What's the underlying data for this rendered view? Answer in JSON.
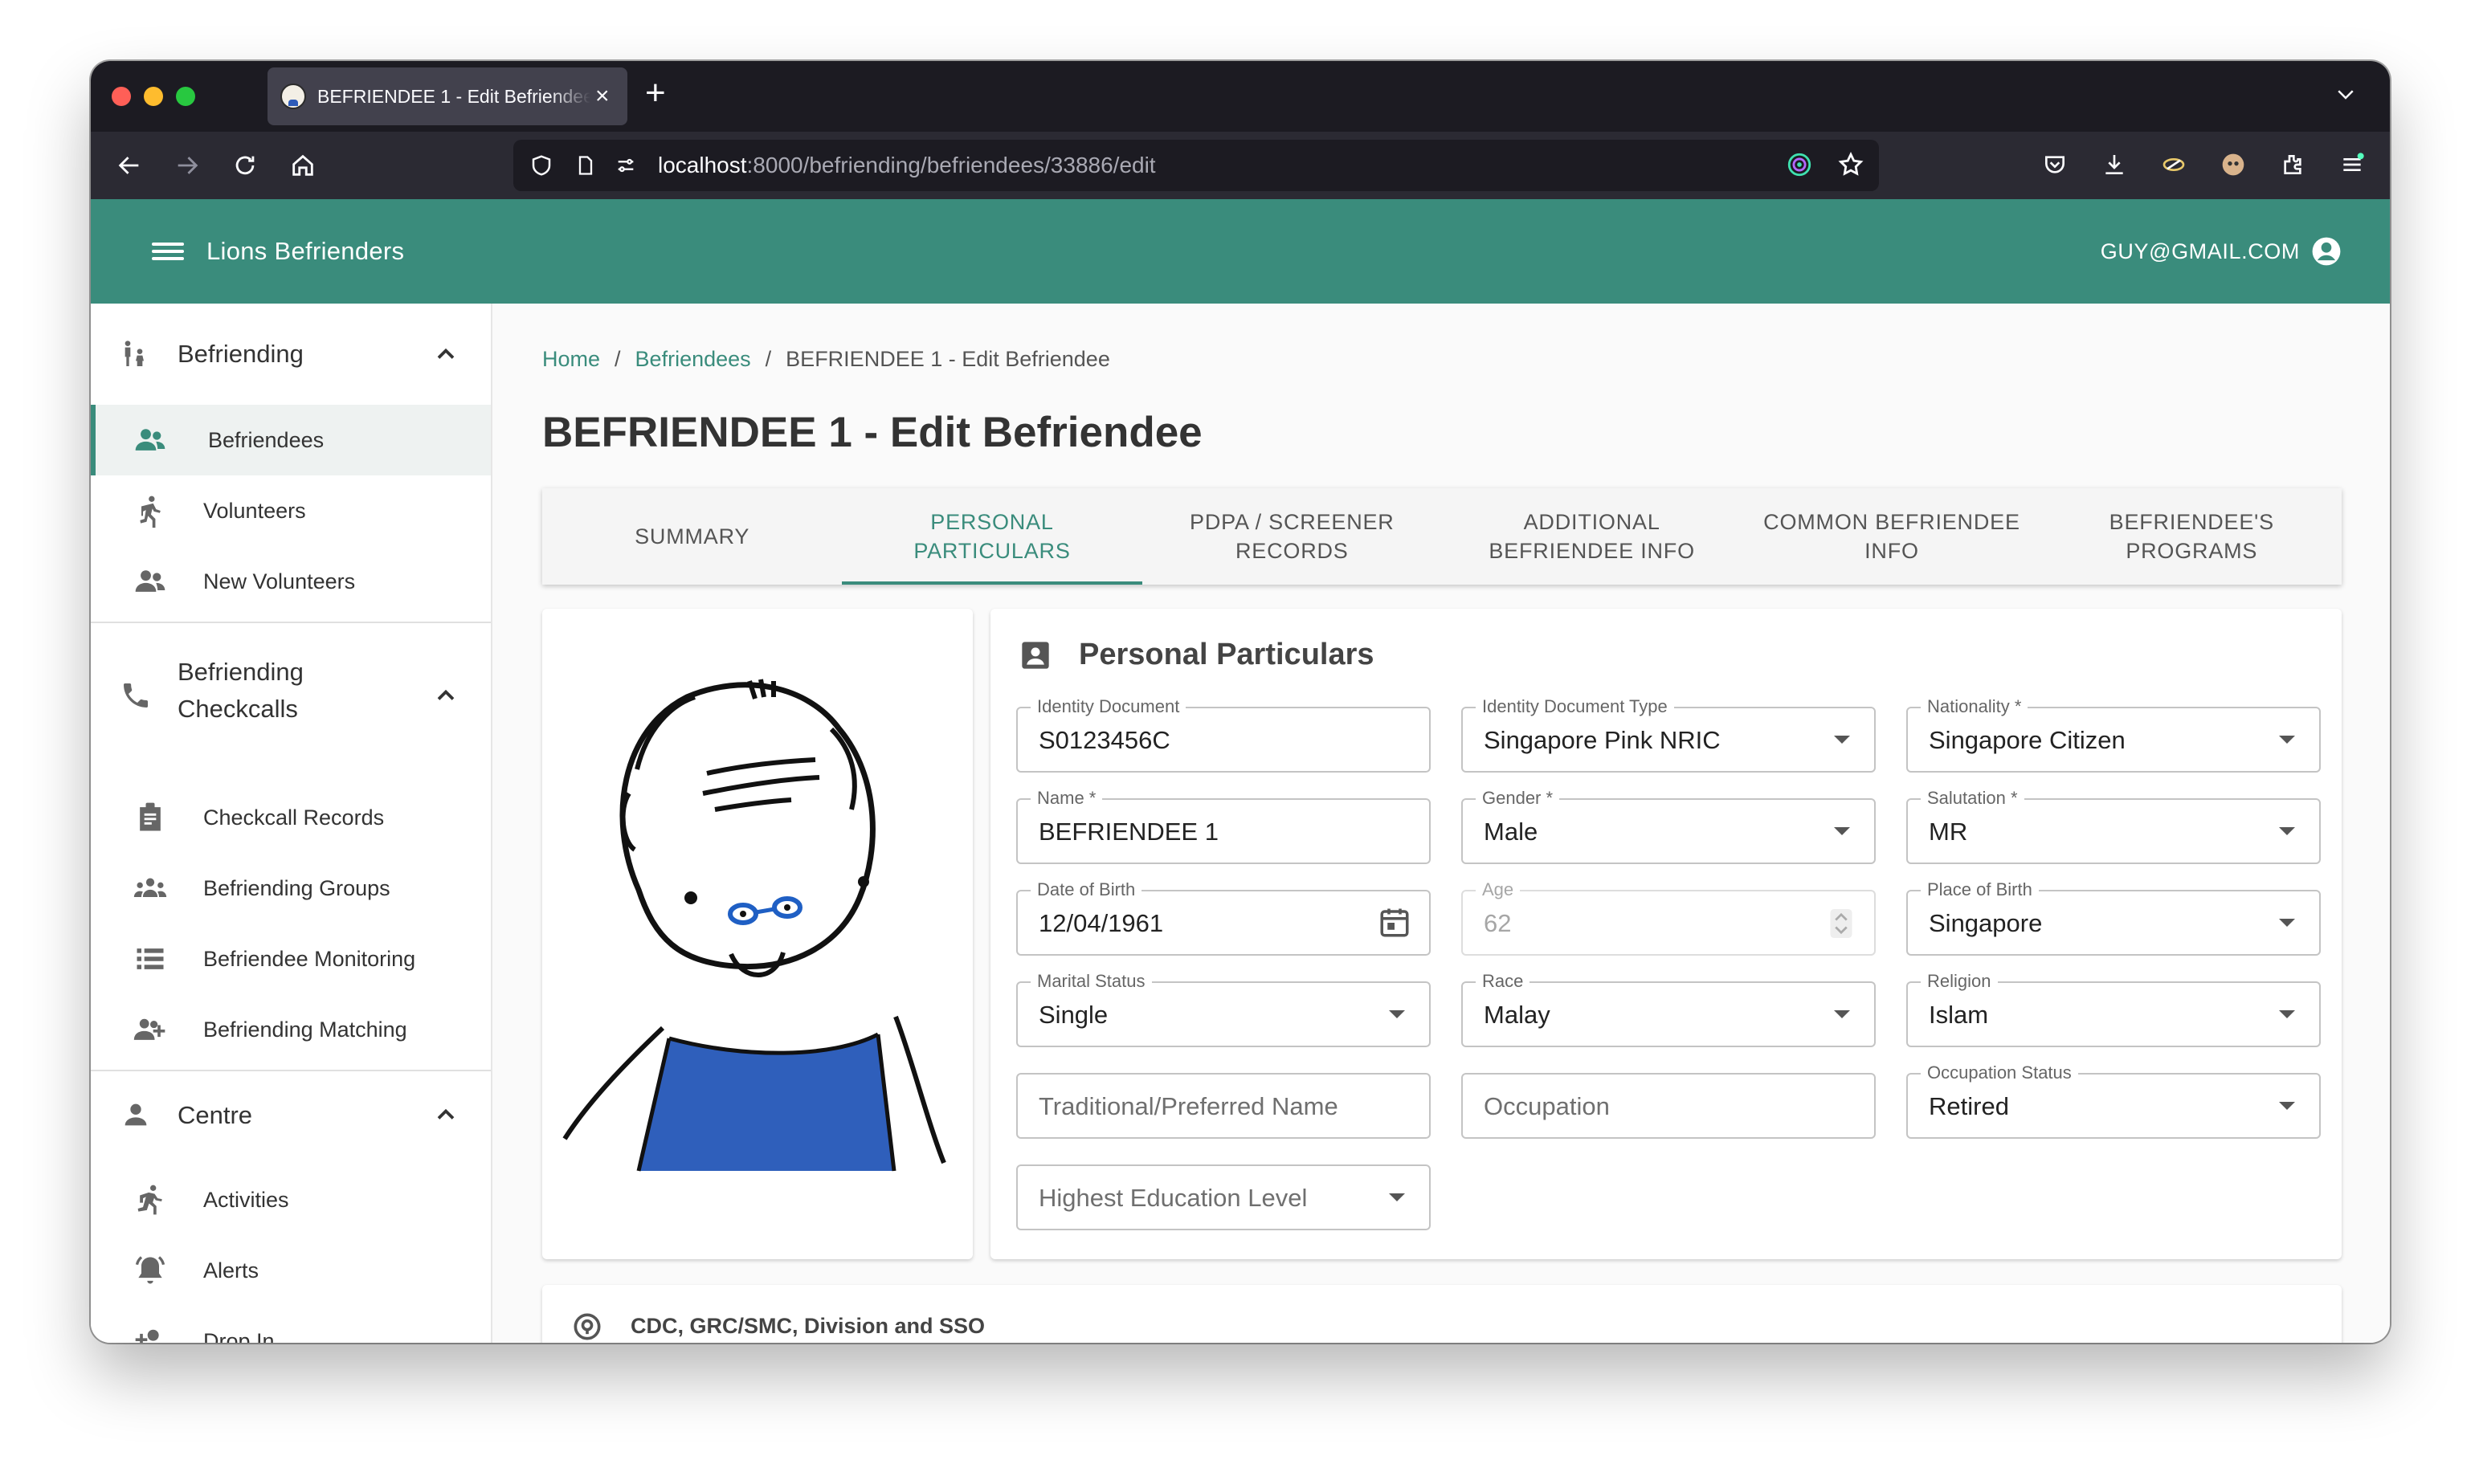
{
  "browser": {
    "tab_title": "BEFRIENDEE 1 - Edit Befriendee",
    "url_host": "localhost",
    "url_path": ":8000/befriending/befriendees/33886/edit"
  },
  "app": {
    "title": "Lions Befrienders",
    "user_email": "GUY@GMAIL.COM"
  },
  "sidebar": {
    "sections": [
      {
        "title": "Befriending",
        "items": [
          {
            "label": "Befriendees",
            "active": true
          },
          {
            "label": "Volunteers"
          },
          {
            "label": "New Volunteers"
          }
        ]
      },
      {
        "title_line1": "Befriending",
        "title_line2": "Checkcalls",
        "items": [
          {
            "label": "Checkcall Records"
          },
          {
            "label": "Befriending Groups"
          },
          {
            "label": "Befriendee Monitoring"
          },
          {
            "label": "Befriending Matching"
          }
        ]
      },
      {
        "title": "Centre",
        "items": [
          {
            "label": "Activities"
          },
          {
            "label": "Alerts"
          },
          {
            "label": "Drop In"
          }
        ]
      }
    ]
  },
  "breadcrumb": {
    "home": "Home",
    "sep": "/",
    "befriendees": "Befriendees",
    "current": "BEFRIENDEE 1 - Edit Befriendee"
  },
  "page_title": "BEFRIENDEE 1 - Edit Befriendee",
  "tabs": [
    {
      "label": "SUMMARY"
    },
    {
      "label": "PERSONAL\nPARTICULARS",
      "active": true
    },
    {
      "label": "PDPA / SCREENER\nRECORDS"
    },
    {
      "label": "ADDITIONAL\nBEFRIENDEE INFO"
    },
    {
      "label": "COMMON BEFRIENDEE\nINFO"
    },
    {
      "label": "BEFRIENDEE'S\nPROGRAMS"
    }
  ],
  "personal": {
    "title": "Personal Particulars",
    "identity_document": {
      "label": "Identity Document",
      "value": "S0123456C"
    },
    "identity_type": {
      "label": "Identity Document Type",
      "value": "Singapore Pink NRIC"
    },
    "nationality": {
      "label": "Nationality *",
      "value": "Singapore Citizen"
    },
    "name": {
      "label": "Name *",
      "value": "BEFRIENDEE 1"
    },
    "gender": {
      "label": "Gender *",
      "value": "Male"
    },
    "salutation": {
      "label": "Salutation *",
      "value": "MR"
    },
    "dob": {
      "label": "Date of Birth",
      "value": "12/04/1961"
    },
    "age": {
      "label": "Age",
      "value": "62"
    },
    "place_of_birth": {
      "label": "Place of Birth",
      "value": "Singapore"
    },
    "marital_status": {
      "label": "Marital Status",
      "value": "Single"
    },
    "race": {
      "label": "Race",
      "value": "Malay"
    },
    "religion": {
      "label": "Religion",
      "value": "Islam"
    },
    "preferred_name": {
      "placeholder": "Traditional/Preferred Name"
    },
    "occupation": {
      "placeholder": "Occupation"
    },
    "occupation_status": {
      "label": "Occupation Status",
      "value": "Retired"
    },
    "education": {
      "placeholder": "Highest Education Level"
    }
  },
  "sso": {
    "title": "CDC, GRC/SMC, Division and SSO"
  },
  "colors": {
    "brand": "#3a8c7c",
    "browser_dark": "#1c1b22"
  }
}
